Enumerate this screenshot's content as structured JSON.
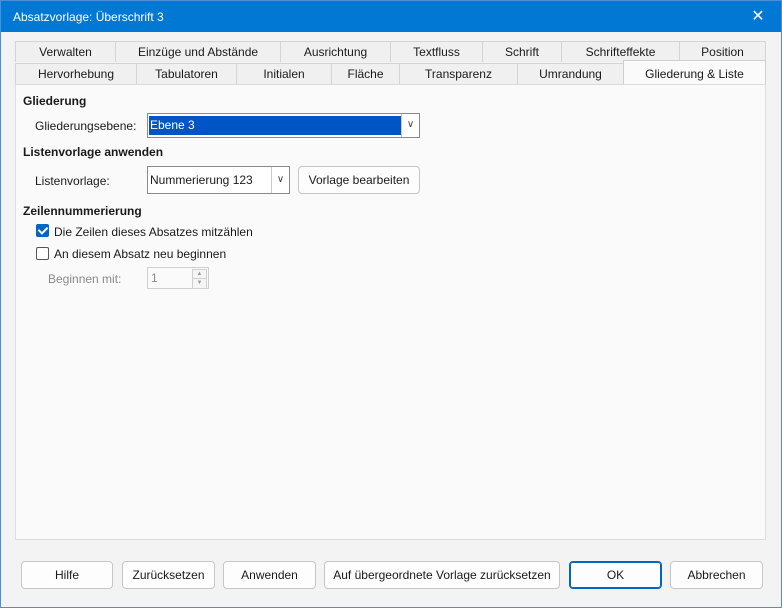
{
  "window": {
    "title": "Absatzvorlage: Überschrift 3",
    "close_glyph": "✕"
  },
  "tabs_row1": [
    "Verwalten",
    "Einzüge und Abstände",
    "Ausrichtung",
    "Textfluss",
    "Schrift",
    "Schrifteffekte",
    "Position"
  ],
  "tabs_row2": [
    "Hervorhebung",
    "Tabulatoren",
    "Initialen",
    "Fläche",
    "Transparenz",
    "Umrandung",
    "Gliederung & Liste"
  ],
  "gliederung": {
    "heading": "Gliederung",
    "level_label": "Gliederungsebene:",
    "level_value": "Ebene 3"
  },
  "liste": {
    "heading": "Listenvorlage anwenden",
    "style_label": "Listenvorlage:",
    "style_value": "Nummerierung 123",
    "edit_button": "Vorlage bearbeiten"
  },
  "zeilen": {
    "heading": "Zeilennummerierung",
    "count_lines": {
      "label": "Die Zeilen dieses Absatzes mitzählen",
      "checked": true
    },
    "restart": {
      "label": "An diesem Absatz neu beginnen",
      "checked": false
    },
    "start_label": "Beginnen mit:",
    "start_value": "1"
  },
  "buttons": {
    "help": "Hilfe",
    "reset": "Zurücksetzen",
    "apply": "Anwenden",
    "reset_parent": "Auf übergeordnete Vorlage zurücksetzen",
    "ok": "OK",
    "cancel": "Abbrechen"
  },
  "colors": {
    "titlebar": "#0078d4",
    "accent": "#0067c0",
    "selection": "#0055c4"
  }
}
